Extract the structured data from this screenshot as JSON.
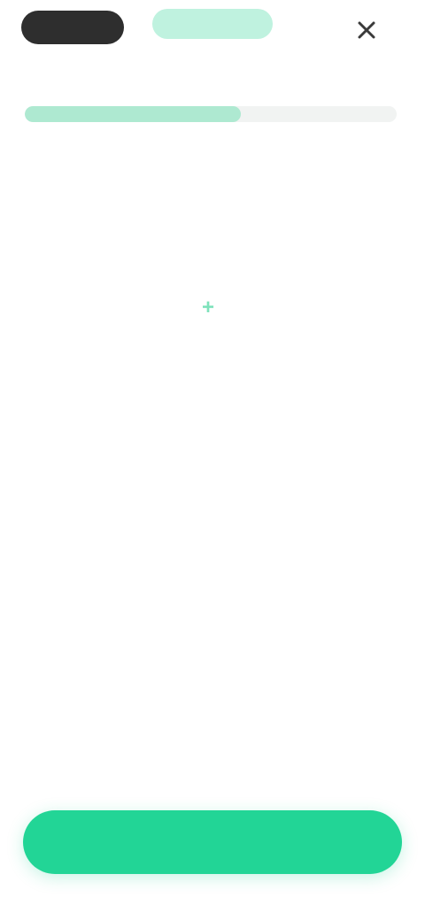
{
  "header": {
    "brand_label": "",
    "step_label": "",
    "close_icon": "close-icon",
    "caption": ""
  },
  "progress": {
    "fraction": 0.58
  },
  "amount": {
    "label": "",
    "value": "",
    "unit": "",
    "change_link_label": "",
    "change_link_icon": "plus-icon"
  },
  "message": {
    "title": "",
    "body": ""
  },
  "primary_button": {
    "label": ""
  },
  "colors": {
    "accent": "#22d596",
    "accent_soft": "#bff2df",
    "progress_fill": "#aee9d1",
    "dark_pill": "#2e2e2e"
  }
}
